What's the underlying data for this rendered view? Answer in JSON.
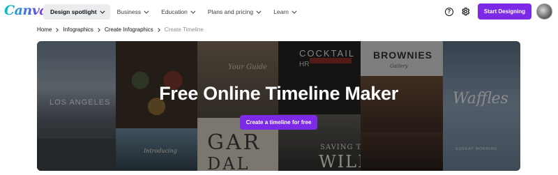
{
  "brand": {
    "logo_text": "Canva",
    "accent": "#7d2ae8"
  },
  "nav": {
    "items": [
      {
        "label": "Design spotlight",
        "active": true
      },
      {
        "label": "Business",
        "active": false
      },
      {
        "label": "Education",
        "active": false
      },
      {
        "label": "Plans and pricing",
        "active": false
      },
      {
        "label": "Learn",
        "active": false
      }
    ],
    "help_icon_glyph": "?",
    "cta_label": "Start Designing"
  },
  "breadcrumb": [
    "Home",
    "Infographics",
    "Create Infographics",
    "Create Timeline"
  ],
  "hero": {
    "title": "Free Online Timeline Maker",
    "button_label": "Create a timeline for free",
    "tile_texts": {
      "los_angeles": "LOS ANGELES",
      "your_guide": "Your Guide",
      "cocktail": "COCKTAIL",
      "cocktail_sub": "HR",
      "brownies": "BROWNIES",
      "brownies_sub": "Gallery",
      "waffles": "Waffles",
      "sunday_morning": "SUNDAY MORNING",
      "introducing": "Introducing",
      "gar": "GAR",
      "dal": "DAL",
      "saving_the": "SAVING THE",
      "wild": "WILD"
    }
  }
}
